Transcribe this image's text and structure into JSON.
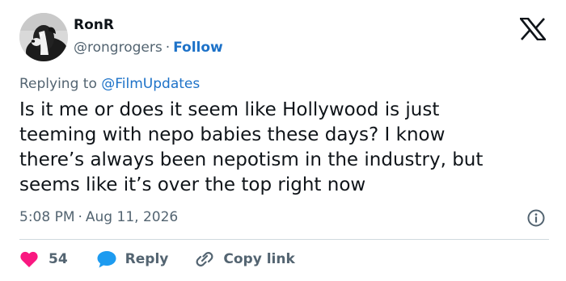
{
  "author": {
    "name": "RonR",
    "handle": "@rongrogers",
    "separator": "·",
    "follow_label": "Follow"
  },
  "reply_context": {
    "prefix": "Replying to ",
    "mention": "@FilmUpdates"
  },
  "tweet": {
    "lines": [
      "Is it me or does it seem like Hollywood is just",
      "teeming with nepo babies these days? I know",
      "there’s always been nepotism in the industry, but",
      "seems like it’s over the top right now"
    ]
  },
  "meta": {
    "time": "5:08 PM",
    "separator": "·",
    "date": "Aug 11, 2026"
  },
  "actions": {
    "like_count": "54",
    "reply_label": "Reply",
    "copy_link_label": "Copy link"
  },
  "icons": {
    "logo": "x-logo-icon",
    "info": "info-icon",
    "like": "heart-icon",
    "reply": "speech-bubble-icon",
    "copy": "link-icon"
  },
  "colors": {
    "text": "#0f1419",
    "secondary": "#536471",
    "link": "#1d72c8",
    "like": "#f91880",
    "reply": "#1d9bf0",
    "divider": "#cfd9de"
  }
}
